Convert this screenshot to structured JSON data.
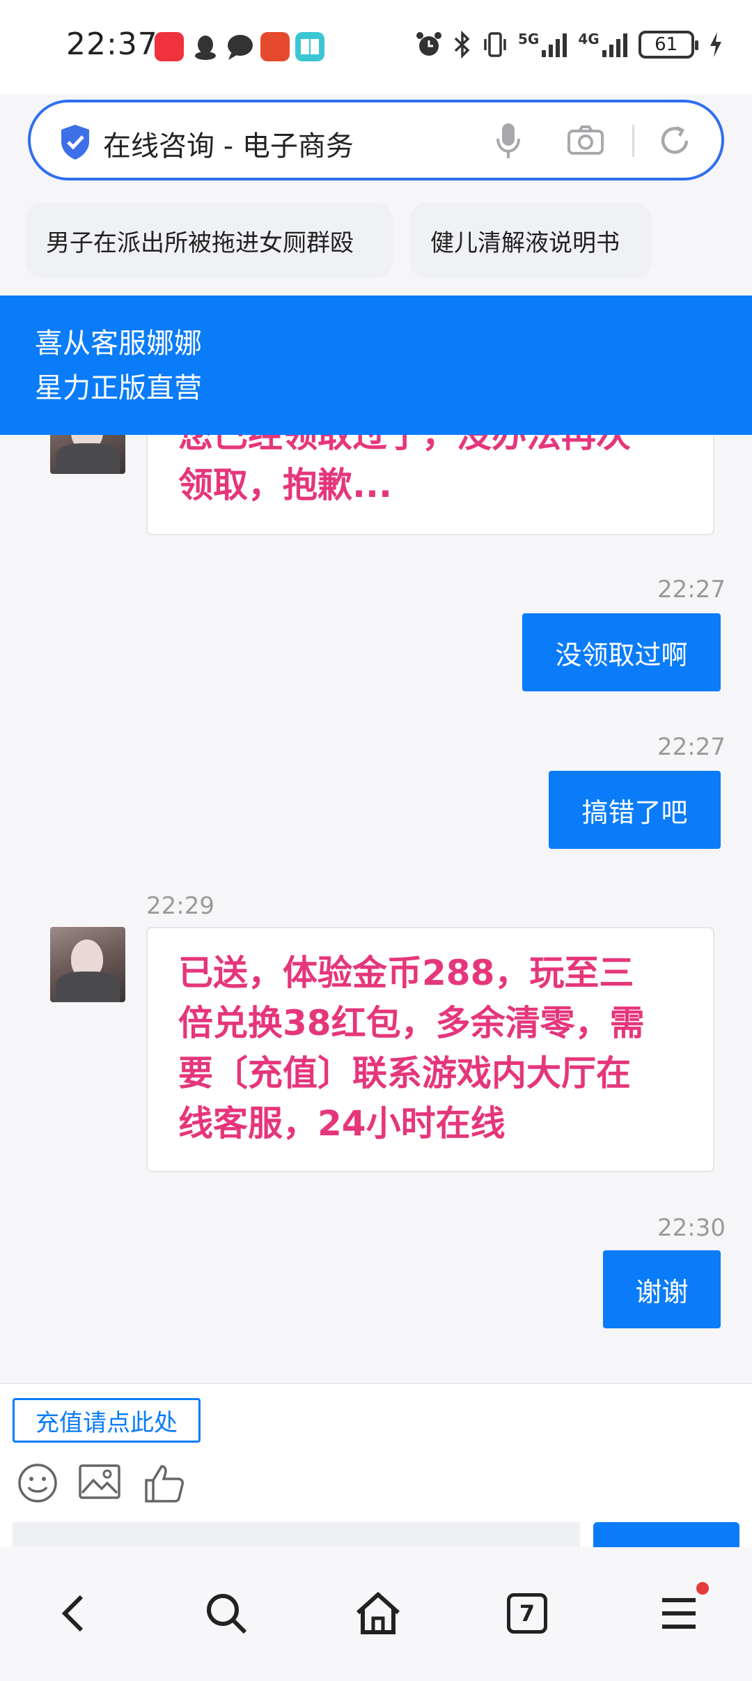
{
  "status_bar": {
    "time": "22:37",
    "battery": "61",
    "net1": "5G",
    "net2": "4G",
    "icons": [
      "alarm-icon",
      "bluetooth-icon",
      "vibrate-icon",
      "signal-5g-icon",
      "signal-4g-icon",
      "battery-icon",
      "charging-icon"
    ]
  },
  "search": {
    "query": "在线咨询 - 电子商务"
  },
  "chips": [
    "男子在派出所被拖进女厕群殴",
    "健儿清解液说明书"
  ],
  "banner": {
    "line1": "喜从客服娜娜",
    "line2": "星力正版直营"
  },
  "messages": [
    {
      "side": "received",
      "time": "",
      "text_lines": [
        "您已经领取过了，没办法再次",
        "领取，抱歉..."
      ]
    },
    {
      "side": "sent",
      "time": "22:27",
      "text": "没领取过啊"
    },
    {
      "side": "sent",
      "time": "22:27",
      "text": "搞错了吧"
    },
    {
      "side": "received",
      "time": "22:29",
      "text_lines": [
        "已送，体验金币288，玩至三",
        "倍兑换38红包，多余清零，需",
        "要〔充值〕联系游戏内大厅在",
        "线客服，24小时在线"
      ]
    },
    {
      "side": "sent",
      "time": "22:30",
      "text": "谢谢"
    }
  ],
  "input_area": {
    "recharge_label": "充值请点此处",
    "tools": [
      "emoji-icon",
      "image-icon",
      "thumbs-up-icon"
    ]
  },
  "nav": {
    "tabs_count": "7",
    "items": [
      "back-icon",
      "search-icon",
      "home-icon",
      "tabs-icon",
      "menu-icon"
    ]
  },
  "colors": {
    "accent": "#0a7cfa",
    "received_text": "#e5367b",
    "search_border": "#2f6ff0"
  }
}
